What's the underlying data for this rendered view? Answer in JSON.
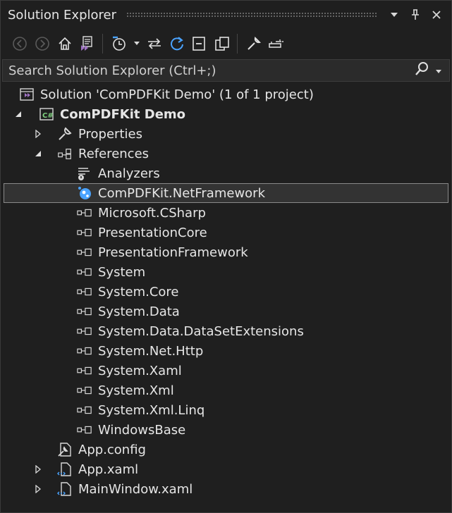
{
  "window": {
    "title": "Solution Explorer"
  },
  "search": {
    "placeholder": "Search Solution Explorer (Ctrl+;)"
  },
  "tree": {
    "solution": "Solution 'ComPDFKit Demo' (1 of 1 project)",
    "project": "ComPDFKit Demo",
    "properties": "Properties",
    "references": "References",
    "refs": [
      "Analyzers",
      "ComPDFKit.NetFramework",
      "Microsoft.CSharp",
      "PresentationCore",
      "PresentationFramework",
      "System",
      "System.Core",
      "System.Data",
      "System.Data.DataSetExtensions",
      "System.Net.Http",
      "System.Xaml",
      "System.Xml",
      "System.Xml.Linq",
      "WindowsBase"
    ],
    "app_config": "App.config",
    "app_xaml": "App.xaml",
    "main_window": "MainWindow.xaml"
  },
  "colors": {
    "accent": "#4aa3ff",
    "vs_purple": "#a074c4",
    "csharp_green": "#3c8c3c"
  }
}
